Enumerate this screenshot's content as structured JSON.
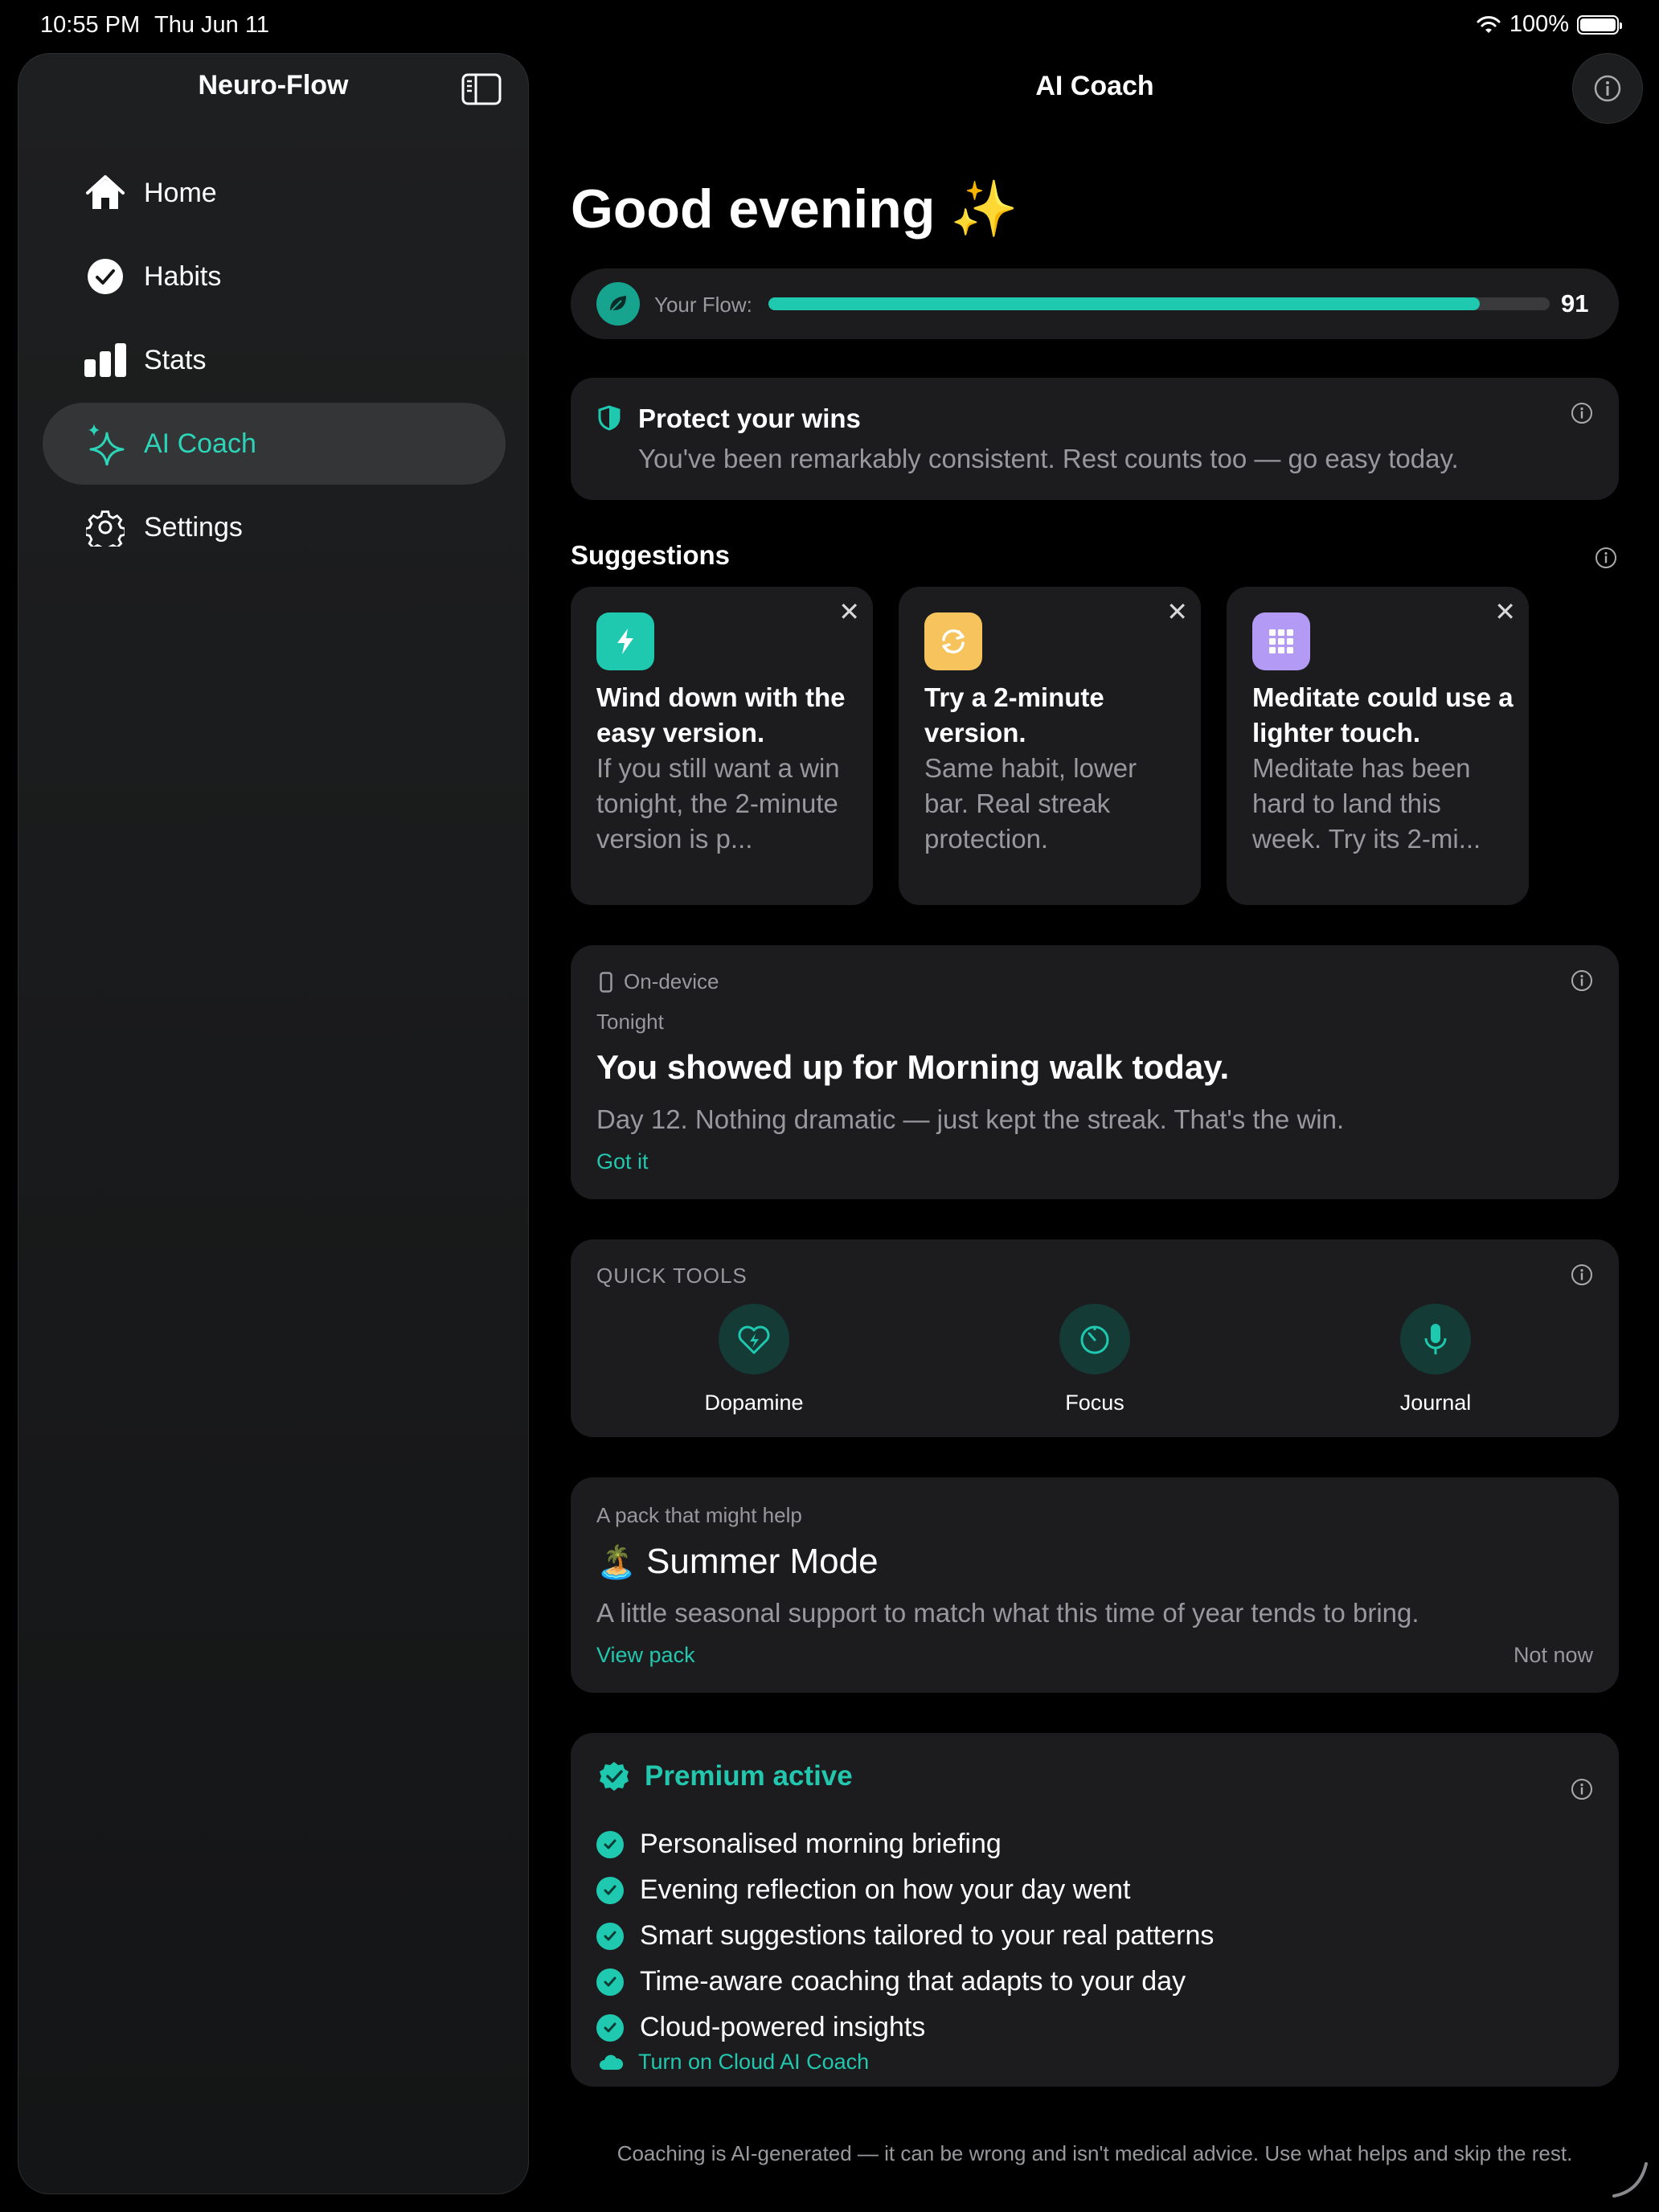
{
  "status_bar": {
    "time": "10:55 PM",
    "date": "Thu Jun 11",
    "battery": "100%"
  },
  "sidebar": {
    "title": "Neuro-Flow",
    "items": [
      {
        "label": "Home",
        "icon": "house-icon"
      },
      {
        "label": "Habits",
        "icon": "checkmark-circle-icon"
      },
      {
        "label": "Stats",
        "icon": "bar-chart-icon"
      },
      {
        "label": "AI Coach",
        "icon": "sparkles-icon",
        "active": true
      },
      {
        "label": "Settings",
        "icon": "gear-icon"
      }
    ]
  },
  "header": {
    "title": "AI Coach"
  },
  "greeting": "Good evening ✨",
  "flow": {
    "label": "Your Flow:",
    "value": "91",
    "fraction": 0.91
  },
  "protect": {
    "title": "Protect your wins",
    "subtitle": "You've been remarkably consistent. Rest counts too — go easy today."
  },
  "suggestions": {
    "heading": "Suggestions",
    "cards": [
      {
        "title": "Wind down with the easy version.",
        "body": "If you still want a win tonight, the 2-minute version is p...",
        "icon": "bolt-icon",
        "color": "#1ec9b0"
      },
      {
        "title": "Try a 2-minute version.",
        "body": "Same habit, lower bar. Real streak protection.",
        "icon": "refresh-icon",
        "color": "#f7c35c"
      },
      {
        "title": "Meditate could use a lighter touch.",
        "body": "Meditate has been hard to land this week. Try its 2-mi...",
        "icon": "grid-icon",
        "color": "#b39bf5"
      }
    ]
  },
  "briefing": {
    "source": "On-device",
    "when": "Tonight",
    "title": "You showed up for Morning walk today.",
    "body": "Day 12. Nothing dramatic — just kept the streak. That's the win.",
    "action": "Got it"
  },
  "quick_tools": {
    "label": "QUICK TOOLS",
    "tools": [
      {
        "label": "Dopamine",
        "icon": "heart-bolt-icon"
      },
      {
        "label": "Focus",
        "icon": "timer-icon"
      },
      {
        "label": "Journal",
        "icon": "microphone-icon"
      }
    ]
  },
  "pack": {
    "label": "A pack that might help",
    "emoji": "🏝️",
    "title": "Summer Mode",
    "body": "A little seasonal support to match what this time of year tends to bring.",
    "view": "View pack",
    "dismiss": "Not now"
  },
  "premium": {
    "title": "Premium active",
    "features": [
      "Personalised morning briefing",
      "Evening reflection on how your day went",
      "Smart suggestions tailored to your real patterns",
      "Time-aware coaching that adapts to your day",
      "Cloud-powered insights"
    ],
    "cloud_action": "Turn on Cloud AI Coach"
  },
  "footer": "Coaching is AI-generated — it can be wrong and isn't medical advice. Use what helps and skip the rest.",
  "colors": {
    "accent": "#1ec9b0",
    "card": "#1c1c1f",
    "background": "#000000"
  }
}
